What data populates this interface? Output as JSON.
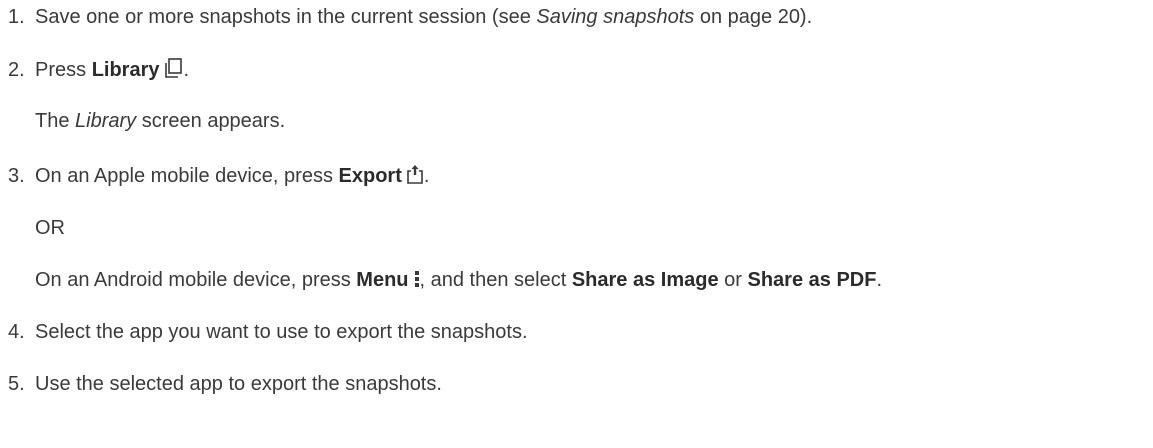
{
  "steps": [
    {
      "number": "1.",
      "text_before": "Save one or more snapshots in the current session (see ",
      "link_italic": "Saving snapshots",
      "text_after": " on page 20)."
    },
    {
      "number": "2.",
      "text_before": "Press ",
      "bold": "Library",
      "icon": "library-icon",
      "text_after": ".",
      "note_before": "The ",
      "note_italic": "Library",
      "note_after": " screen appears."
    },
    {
      "number": "3.",
      "text_before": "On an Apple mobile device, press ",
      "bold": "Export",
      "icon": "export-icon",
      "text_after": ".",
      "or_label": "OR",
      "alt_before": "On an Android mobile device, press ",
      "alt_bold_menu": "Menu",
      "alt_icon": "menu-icon",
      "alt_mid": ", and then select ",
      "alt_bold_image": "Share as Image",
      "alt_or": " or ",
      "alt_bold_pdf": "Share as PDF",
      "alt_after": "."
    },
    {
      "number": "4.",
      "text": "Select the app you want to use to export the snapshots."
    },
    {
      "number": "5.",
      "text": "Use the selected app to export the snapshots."
    }
  ]
}
